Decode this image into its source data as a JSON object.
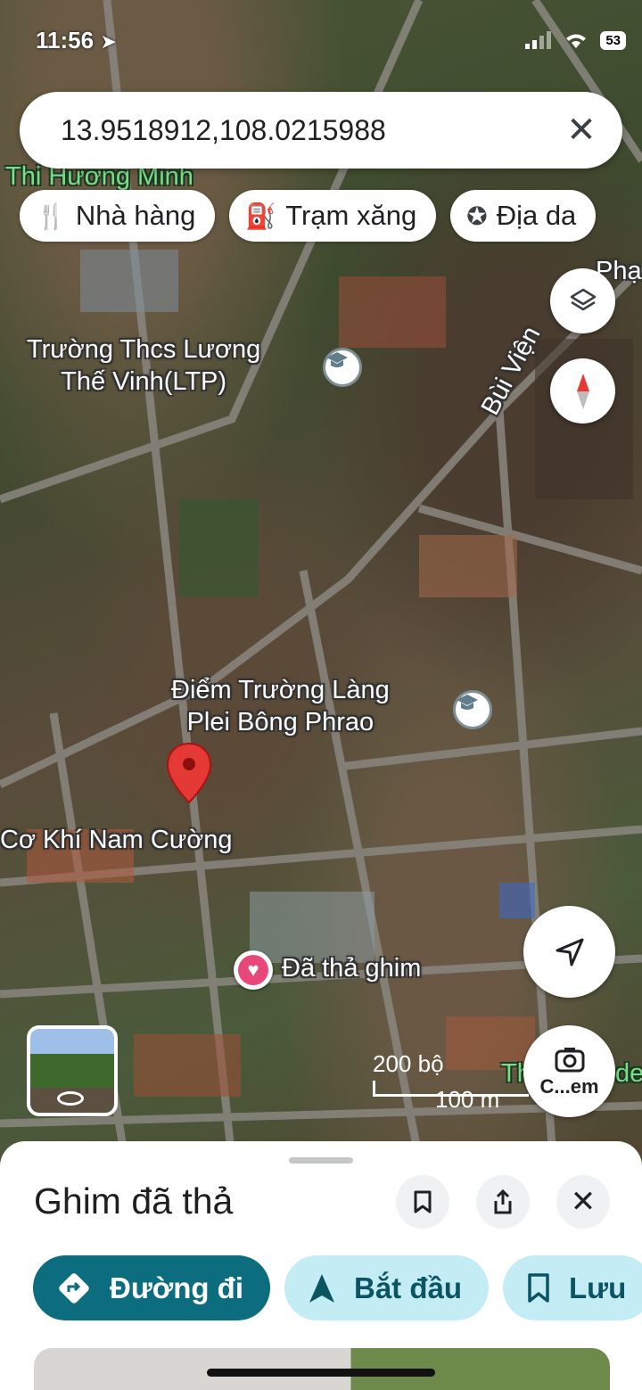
{
  "status_bar": {
    "time": "11:56",
    "battery": "53"
  },
  "search": {
    "value": "13.9518912,108.0215988"
  },
  "chips": [
    {
      "label": "Nhà hàng",
      "icon": "restaurant-icon"
    },
    {
      "label": "Trạm xăng",
      "icon": "gas-station-icon"
    },
    {
      "label": "Địa da",
      "icon": "attraction-icon"
    }
  ],
  "map_labels": {
    "top_green": "Thi Hương Minh",
    "school1": "Trường Thcs Lương\nThế Vinh(LTP)",
    "street": "Bùi Viện",
    "corner": "Phạ",
    "school2": "Điểm Trường Làng\nPlei Bông Phrao",
    "workshop": "Cơ Khí Nam Cường",
    "dropped": "Đã thả ghim",
    "bottom_green": "Th",
    "bottom_green2": "de"
  },
  "scale": {
    "imperial": "200 bộ",
    "metric": "100 m"
  },
  "camera_label": "C...em",
  "sheet": {
    "title": "Ghim đã thả",
    "actions": [
      {
        "label": "Đường đi",
        "icon": "directions-icon"
      },
      {
        "label": "Bắt đầu",
        "icon": "navigation-arrow-icon"
      },
      {
        "label": "Lưu",
        "icon": "bookmark-icon"
      }
    ]
  },
  "colors": {
    "primary": "#0b6d7e",
    "secondary": "#c3ecf5",
    "pin": "#e53935",
    "saved_pin": "#e8477a"
  }
}
